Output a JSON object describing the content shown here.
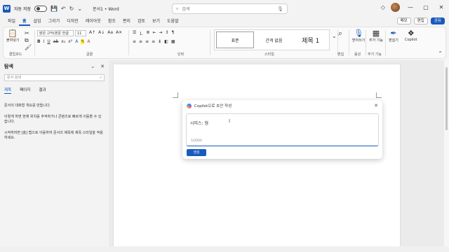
{
  "titlebar": {
    "autosave_label": "자동 저장",
    "doc_title": "문서1 • Word",
    "search_placeholder": "검색",
    "app_letter": "W"
  },
  "menu": {
    "tabs": [
      "파일",
      "홈",
      "삽입",
      "그리기",
      "디자인",
      "레이아웃",
      "참조",
      "편지",
      "검토",
      "보기",
      "도움말"
    ],
    "active_tab": "홈",
    "comment_label": "메모",
    "edit_label": "편집",
    "share_label": "공유"
  },
  "ribbon": {
    "paste_label": "붙여넣기",
    "font_name": "맑은 고딕(본문 한글",
    "font_size": "11",
    "clipboard_label": "클립보드",
    "font_group_label": "글꼴",
    "paragraph_label": "단락",
    "styles_label": "스타일",
    "styles": [
      "표준",
      "간격 없음",
      "제목 1"
    ],
    "edit_group": "편집",
    "dictate_label": "받아쓰기",
    "voice_label": "음성",
    "addins_label": "추가 기능",
    "addins_group": "추가 기능",
    "editor_label": "편집기",
    "copilot_label": "Copilot"
  },
  "nav": {
    "title": "탐색",
    "search_placeholder": "문서 검색",
    "tabs": [
      "제목",
      "페이지",
      "결과"
    ],
    "text1": "문서의 대화형 개요를 만듭니다.",
    "text2": "이렇게 하면 현재 위치를 추적하거나 콘텐츠로 빠르게 이동할 수 있습니다.",
    "text3": "시작하려면 [홈] 탭으로 이동하여 문서의 제목에 제목 스타일을 적용하세요."
  },
  "copilot": {
    "title": "Copilot으로 초안 작성",
    "input_text": "시피스: 혐",
    "counter": "5/2000",
    "generate_label": "생성"
  },
  "colors": {
    "accent": "#185abd"
  }
}
